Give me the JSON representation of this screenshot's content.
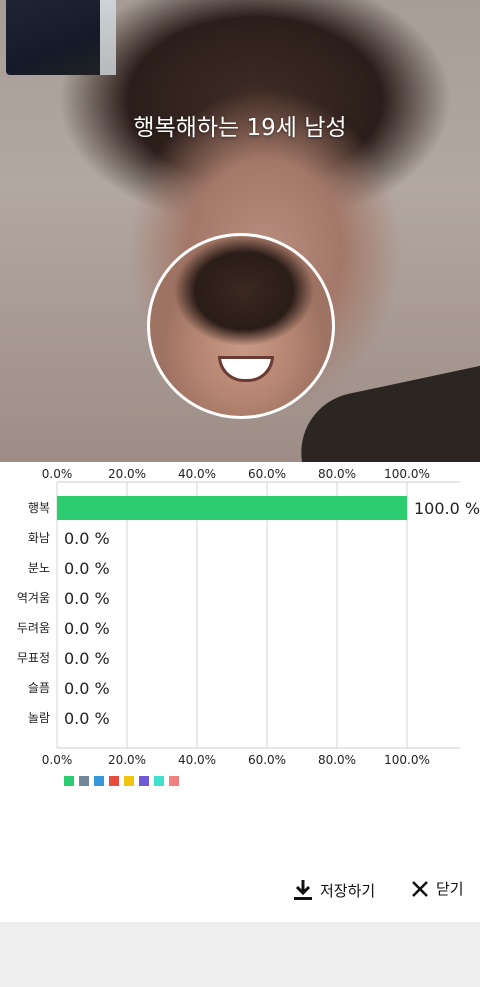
{
  "result": {
    "title": "행복해하는 19세 남성"
  },
  "chart_data": {
    "type": "bar",
    "orientation": "horizontal",
    "categories": [
      "행복",
      "화남",
      "분노",
      "역겨움",
      "두려움",
      "무표정",
      "슬픔",
      "놀람"
    ],
    "values": [
      100.0,
      0.0,
      0.0,
      0.0,
      0.0,
      0.0,
      0.0,
      0.0
    ],
    "value_labels": [
      "100.0 %",
      "0.0 %",
      "0.0 %",
      "0.0 %",
      "0.0 %",
      "0.0 %",
      "0.0 %",
      "0.0 %"
    ],
    "xticks": [
      "0.0%",
      "20.0%",
      "40.0%",
      "60.0%",
      "80.0%",
      "100.0%"
    ],
    "xlim": [
      0,
      100
    ],
    "grid": true,
    "bar_color": "#2ecc71",
    "legend_colors": [
      "#2ecc71",
      "#708898",
      "#3498db",
      "#e74c3c",
      "#f1c40f",
      "#7158d4",
      "#40e0d0",
      "#f08080"
    ]
  },
  "actions": {
    "save_label": "저장하기",
    "close_label": "닫기"
  }
}
